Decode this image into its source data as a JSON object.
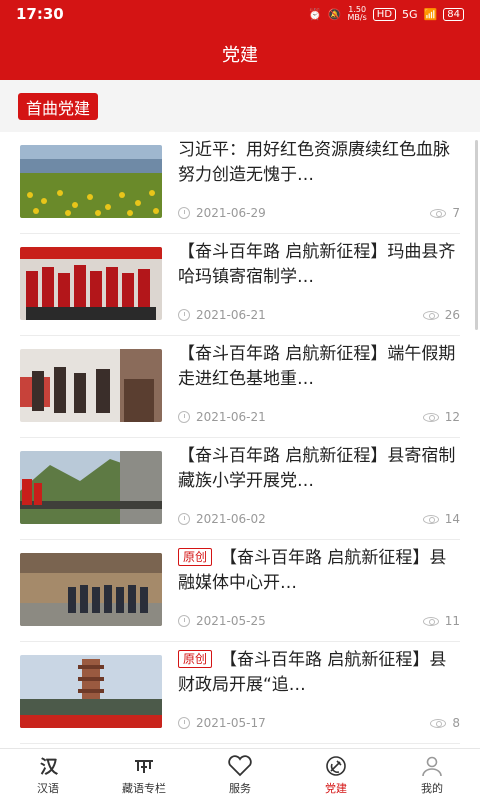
{
  "status": {
    "time": "17:30",
    "speed_value": "1.50",
    "speed_unit": "MB/s",
    "hd": "HD",
    "net": "5G",
    "battery": "84"
  },
  "header": {
    "title": "党建"
  },
  "section": {
    "tag": "首曲党建"
  },
  "articles": [
    {
      "title": "习近平：用好红色资源赓续红色血脉 努力创造无愧于…",
      "badge": "",
      "date": "2021-06-29",
      "views": "7"
    },
    {
      "title": "【奋斗百年路 启航新征程】玛曲县齐哈玛镇寄宿制学…",
      "badge": "",
      "date": "2021-06-21",
      "views": "26"
    },
    {
      "title": "【奋斗百年路 启航新征程】端午假期走进红色基地重…",
      "badge": "",
      "date": "2021-06-21",
      "views": "12"
    },
    {
      "title": "【奋斗百年路 启航新征程】县寄宿制藏族小学开展党…",
      "badge": "",
      "date": "2021-06-02",
      "views": "14"
    },
    {
      "title": "【奋斗百年路 启航新征程】县融媒体中心开…",
      "badge": "原创",
      "date": "2021-05-25",
      "views": "11"
    },
    {
      "title": "【奋斗百年路 启航新征程】县财政局开展“追…",
      "badge": "原创",
      "date": "2021-05-17",
      "views": "8"
    }
  ],
  "tabs": [
    {
      "label": "汉语",
      "icon": "han-char-icon"
    },
    {
      "label": "藏语专栏",
      "icon": "tibetan-script-icon"
    },
    {
      "label": "服务",
      "icon": "heart-icon"
    },
    {
      "label": "党建",
      "icon": "party-emblem-icon"
    },
    {
      "label": "我的",
      "icon": "person-icon"
    }
  ],
  "colors": {
    "brand": "#d41414",
    "tab_inactive": "#333333",
    "meta_text": "#999999"
  }
}
